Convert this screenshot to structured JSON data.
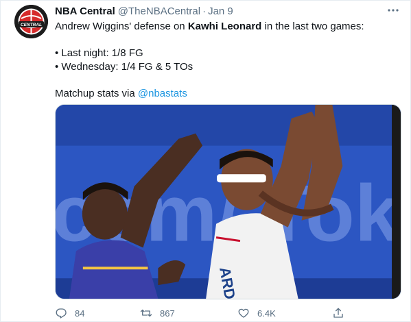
{
  "tweet": {
    "author": {
      "display_name": "NBA Central",
      "handle": "@TheNBACentral",
      "avatar_icon": "nba-central-logo",
      "avatar_text": "CENTRAL"
    },
    "separator": "·",
    "timestamp": "Jan 9",
    "text": {
      "line1_prefix": "Andrew Wiggins' defense on ",
      "line1_bold": "Kawhi Leonard",
      "line1_suffix": " in the last two games:",
      "bullet1": "• Last night: 1/8 FG",
      "bullet2": "• Wednesday: 1/4 FG & 5 TOs",
      "line3_prefix": "Matchup stats via ",
      "line3_mention": "@nbastats"
    },
    "media": {
      "background_text": "com/ Token",
      "jersey_text": "ARD"
    },
    "actions": {
      "reply_count": "84",
      "retweet_count": "867",
      "like_count": "6.4K",
      "reply_icon": "reply-icon",
      "retweet_icon": "retweet-icon",
      "like_icon": "heart-icon",
      "share_icon": "share-icon"
    }
  },
  "colors": {
    "accent": "#1b95e0",
    "muted": "#5b7083",
    "text": "#0f1419",
    "court_blue": "#2a4fb5"
  }
}
